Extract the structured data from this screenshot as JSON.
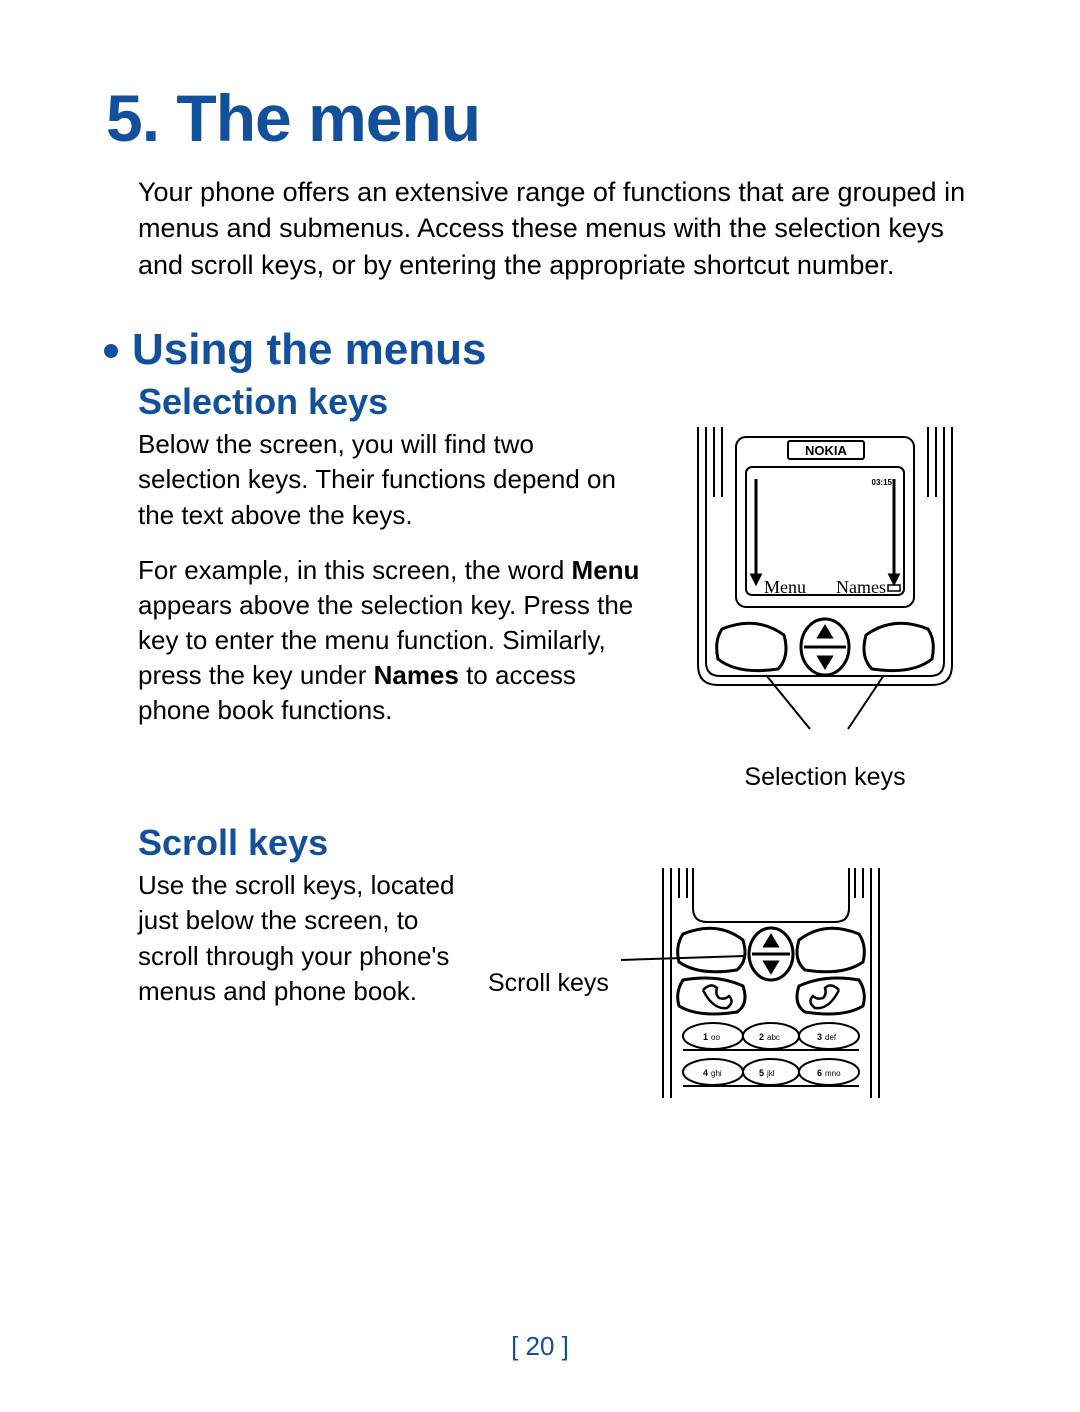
{
  "chapter": {
    "number": "5.",
    "title": "The menu"
  },
  "intro": "Your phone offers an extensive range of functions that are grouped in menus and submenus. Access these menus with the selection keys and scroll keys, or by entering the appropriate shortcut number.",
  "section": {
    "title": "Using the menus"
  },
  "selection": {
    "title": "Selection keys",
    "p1": "Below the screen, you will find two selection keys. Their functions depend on the text above the keys.",
    "p2a": "For example, in this screen, the word ",
    "p2b": "Menu",
    "p2c": " appears above the selection key. Press the key to enter the menu function. Similarly, press the key under ",
    "p2d": "Names",
    "p2e": " to access phone book functions.",
    "figure_caption": "Selection keys",
    "screen": {
      "brand": "NOKIA",
      "time": "03:15",
      "softkey_left": "Menu",
      "softkey_right": "Names"
    }
  },
  "scroll": {
    "title": "Scroll keys",
    "p1": "Use the scroll keys, located just below the screen, to scroll through your phone's menus and phone book.",
    "figure_label": "Scroll keys",
    "keypad": {
      "k1": "1",
      "k1s": "oo",
      "k2": "2",
      "k2s": "abc",
      "k3": "3",
      "k3s": "def",
      "k4": "4",
      "k4s": "ghi",
      "k5": "5",
      "k5s": "jkl",
      "k6": "6",
      "k6s": "mno"
    }
  },
  "page_number": "[ 20 ]"
}
